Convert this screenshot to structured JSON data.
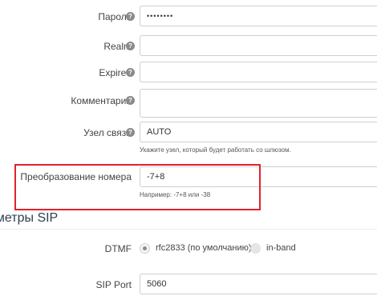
{
  "form": {
    "password": {
      "label": "Пароль",
      "value": "••••••••"
    },
    "realm": {
      "label": "Realm",
      "value": ""
    },
    "expired": {
      "label": "Expired",
      "value": ""
    },
    "comment": {
      "label": "Комментарий",
      "value": ""
    },
    "gateway": {
      "label": "Узел связи",
      "value": "AUTO",
      "hint": "Укажите узел, который будет работать со шлюзом."
    },
    "number_transform": {
      "label": "Преобразование номера",
      "value": "-7+8",
      "hint": "Например: -7+8 или -38"
    }
  },
  "sip_section": {
    "title": "аметры SIP",
    "dtmf": {
      "label": "DTMF",
      "options": [
        "rfc2833 (по умолчанию)",
        "in-band"
      ],
      "selected": "rfc2833 (по умолчанию)"
    },
    "sip_port": {
      "label": "SIP Port",
      "value": "5060"
    }
  },
  "colors": {
    "highlight": "#e0232b",
    "section_title": "#2d3e50",
    "help_icon": "#8a8a8a"
  },
  "icons": {
    "help": "question-circle-icon"
  }
}
